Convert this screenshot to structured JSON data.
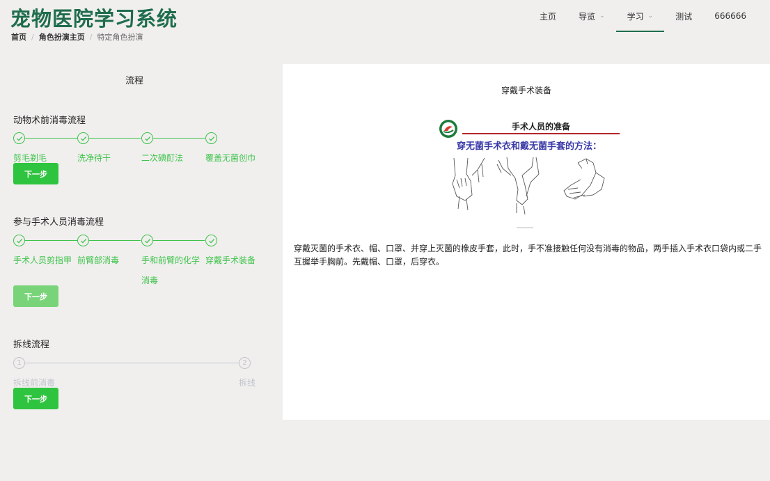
{
  "header": {
    "app_title": "宠物医院学习系统",
    "breadcrumb": [
      "首页",
      "角色扮演主页",
      "特定角色扮演"
    ],
    "breadcrumb_sep": "/",
    "nav": [
      {
        "label": "主页"
      },
      {
        "label": "导览",
        "chevron": "⌄"
      },
      {
        "label": "学习",
        "chevron": "⌄",
        "active": true
      },
      {
        "label": "测试"
      },
      {
        "label": "666666"
      }
    ]
  },
  "left": {
    "title": "流程",
    "sections": [
      {
        "title": "动物术前消毒流程",
        "steps": [
          "剪毛剃毛",
          "洗净待干",
          "二次碘酊法",
          "覆盖无菌创巾"
        ],
        "button": "下一步"
      },
      {
        "title": "参与手术人员消毒流程",
        "steps": [
          "手术人员剪指甲",
          "前臂部消毒",
          "手和前臂的化学消毒",
          "穿戴手术装备"
        ],
        "button": "下一步"
      },
      {
        "title": "拆线流程",
        "steps": [
          "拆线前消毒",
          "拆线"
        ],
        "step_numbers": [
          "1",
          "2"
        ],
        "button": "下一步"
      }
    ]
  },
  "content": {
    "title": "穿戴手术装备",
    "illustration_header": "手术人员的准备",
    "illustration_subtitle": "穿无菌手术衣和戴无菌手套的方法：",
    "description": "穿戴灭菌的手术衣、帽、口罩、并穿上灭菌的橡皮手套，此时，手不准接触任何没有消毒的物品，两手插入手术衣口袋内或二手互握举手胸前。先戴帽、口罩，后穿衣。"
  },
  "colors": {
    "brand_green": "#1f6d4d",
    "step_green": "#3ec34a",
    "button_green": "#2fc43f",
    "button_disabled": "#79d479",
    "wait_gray": "#c0c4cc"
  }
}
